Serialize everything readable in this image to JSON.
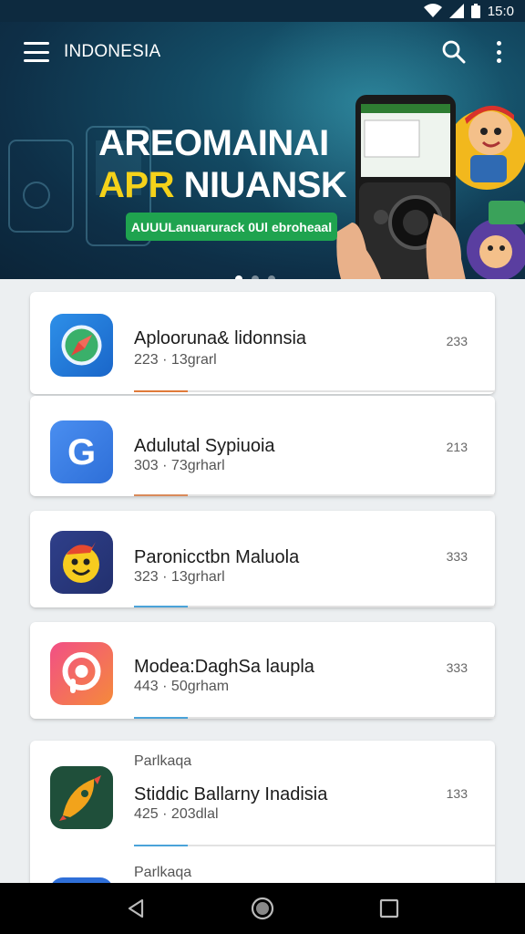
{
  "status_bar": {
    "time": "15:0"
  },
  "app_bar": {
    "title": "INDONESIA",
    "menu_icon": "menu-icon",
    "search_icon": "search-icon",
    "more_icon": "more-vert-icon"
  },
  "hero": {
    "headline_line1": "AREOMAINAI",
    "headline_line2_accent": "APR",
    "headline_line2_rest": "NIUANSK",
    "cta_label": "AUUULanuarurack 0Ul ebroheaal",
    "carousel_pages": 3,
    "carousel_active": 1,
    "colors": {
      "accent_yellow": "#f5d21a",
      "cta_green": "#1fa34f"
    }
  },
  "apps": [
    {
      "name": "Aplooruna& lidonnsia",
      "meta": "223 · 13grarl",
      "count": "233",
      "icon": "compass-icon",
      "progress": 0.15,
      "progress_color": "#e07a3a"
    },
    {
      "name": "Adulutal Sypiuoia",
      "meta": "303 · 73grharl",
      "count": "213",
      "icon": "google-g-icon",
      "progress": 0.15,
      "progress_color": "#d98a5a"
    },
    {
      "name": "Paronicctbn Maluola",
      "meta": "323 · 13grharl",
      "count": "333",
      "icon": "smiley-character-icon",
      "progress": 0.15,
      "progress_color": "#4aa3d9"
    },
    {
      "name": "Modea:DaghSa laupla",
      "meta": "443 · 50grham",
      "count": "333",
      "icon": "podcast-icon",
      "progress": 0.15,
      "progress_color": "#4aa3d9"
    },
    {
      "section": "Parlkaqa",
      "name": "Stiddic Ballarny Inadisia",
      "meta": "425 · 203dlal",
      "count": "133",
      "icon": "rocket-icon",
      "progress": 0.15,
      "progress_color": "#4aa3d9"
    },
    {
      "section": "Parlkaqa",
      "icon": "blue-app-icon"
    }
  ],
  "nav": {
    "back": "back-icon",
    "home": "home-icon",
    "recents": "recents-icon"
  }
}
